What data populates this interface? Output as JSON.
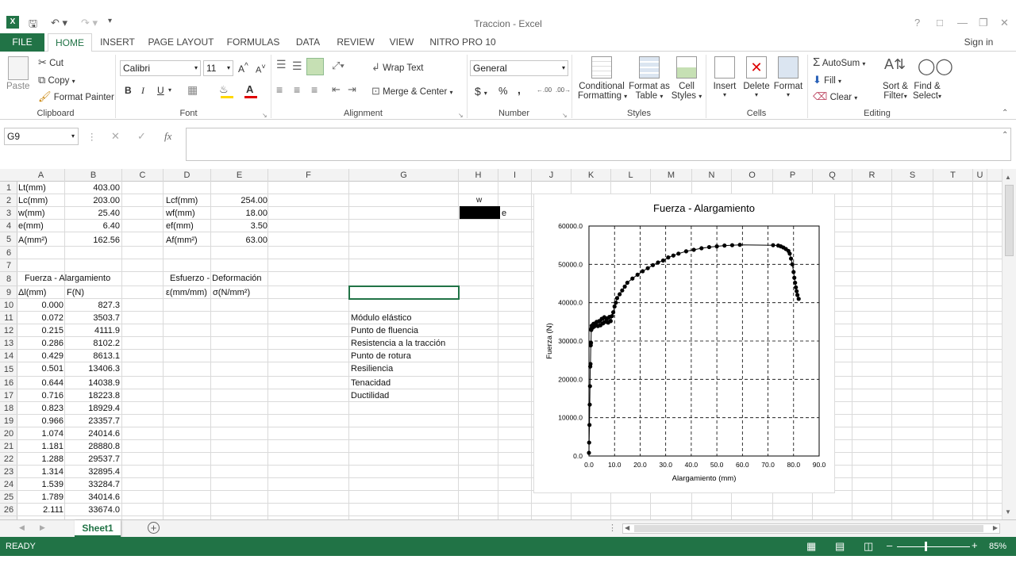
{
  "window": {
    "title": "Traccion - Excel",
    "sign_in": "Sign in",
    "help": "?"
  },
  "ribbon_tabs": [
    "FILE",
    "HOME",
    "INSERT",
    "PAGE LAYOUT",
    "FORMULAS",
    "DATA",
    "REVIEW",
    "VIEW",
    "NITRO PRO 10"
  ],
  "clipboard": {
    "paste": "Paste",
    "cut": "Cut",
    "copy": "Copy",
    "format_painter": "Format Painter",
    "label": "Clipboard"
  },
  "font": {
    "name": "Calibri",
    "size": "11",
    "label": "Font",
    "bold": "B",
    "italic": "I",
    "underline": "U"
  },
  "alignment": {
    "wrap": "Wrap Text",
    "merge": "Merge & Center",
    "label": "Alignment"
  },
  "number": {
    "format": "General",
    "currency": "$",
    "percent": "%",
    "comma": ",",
    "label": "Number"
  },
  "styles": {
    "conditional": "Conditional",
    "conditional2": "Formatting",
    "format_table": "Format as",
    "format_table2": "Table",
    "cell_styles": "Cell",
    "cell_styles2": "Styles",
    "label": "Styles"
  },
  "cells_group": {
    "insert": "Insert",
    "delete": "Delete",
    "format": "Format",
    "label": "Cells"
  },
  "editing": {
    "autosum": "AutoSum",
    "fill": "Fill",
    "clear": "Clear",
    "sort": "Sort &",
    "sort2": "Filter",
    "find": "Find &",
    "find2": "Select",
    "label": "Editing"
  },
  "formula_bar": {
    "name_box": "G9",
    "fx": "fx",
    "cancel": "✕",
    "enter": "✓",
    "value": ""
  },
  "columns": [
    "A",
    "B",
    "C",
    "D",
    "E",
    "F",
    "G",
    "H",
    "I",
    "J",
    "K",
    "L",
    "M",
    "N",
    "O",
    "P",
    "Q",
    "R",
    "S",
    "T",
    "U"
  ],
  "rows": [
    "1",
    "2",
    "3",
    "4",
    "5",
    "6",
    "7",
    "8",
    "9",
    "10",
    "11",
    "12",
    "13",
    "14",
    "15",
    "16",
    "17",
    "18",
    "19",
    "20",
    "21",
    "22",
    "23",
    "24",
    "25",
    "26"
  ],
  "sheet": {
    "a1": "Lt(mm)",
    "b1": "403.00",
    "a2": "Lc(mm)",
    "b2": "203.00",
    "d2": "Lcf(mm)",
    "e2": "254.00",
    "h2": "w",
    "a3": "w(mm)",
    "b3": "25.40",
    "d3": "wf(mm)",
    "e3": "18.00",
    "i3": "e",
    "a4": "e(mm)",
    "b4": "6.40",
    "d4": "ef(mm)",
    "e4": "3.50",
    "a5": "A(mm²)",
    "b5": "162.56",
    "d5": "Af(mm²)",
    "e5": "63.00",
    "a8": "Fuerza - Alargamiento",
    "d8": "Esfuerzo - Deformación",
    "a9": "Δl(mm)",
    "b9": "F(N)",
    "d9": "ε(mm/mm)",
    "e9": "σ(N/mm²)",
    "g_labels": [
      "Módulo elástico",
      "Punto de fluencia",
      "Resistencia a la tracción",
      "Punto de rotura",
      "Resiliencia",
      "Tenacidad",
      "Ductilidad"
    ],
    "dl": [
      "0.000",
      "0.072",
      "0.215",
      "0.286",
      "0.429",
      "0.501",
      "0.644",
      "0.716",
      "0.823",
      "0.966",
      "1.074",
      "1.181",
      "1.288",
      "1.314",
      "1.539",
      "1.789",
      "2.111"
    ],
    "f": [
      "827.3",
      "3503.7",
      "4111.9",
      "8102.2",
      "8613.1",
      "13406.3",
      "14038.9",
      "18223.8",
      "18929.4",
      "23357.7",
      "24014.6",
      "28880.8",
      "29537.7",
      "32895.4",
      "33284.7",
      "34014.6",
      "33674.0"
    ]
  },
  "sheet_tab": "Sheet1",
  "status": {
    "ready": "READY",
    "zoom": "85%"
  },
  "chart_data": {
    "type": "scatter",
    "title": "Fuerza - Alargamiento",
    "xlabel": "Alargamiento (mm)",
    "ylabel": "Fuerza (N)",
    "xlim": [
      0,
      90
    ],
    "ylim": [
      0,
      60000
    ],
    "xticks": [
      "0.0",
      "10.0",
      "20.0",
      "30.0",
      "40.0",
      "50.0",
      "60.0",
      "70.0",
      "80.0",
      "90.0"
    ],
    "yticks": [
      "0.0",
      "10000.0",
      "20000.0",
      "30000.0",
      "40000.0",
      "50000.0",
      "60000.0"
    ],
    "grid": true,
    "series": [
      {
        "x": [
          0.0,
          0.07,
          0.2,
          0.3,
          0.4,
          0.5,
          0.6,
          0.7,
          0.8,
          0.9,
          1.0,
          1.1,
          1.2,
          1.3,
          1.5,
          1.8,
          2.1,
          2.5,
          3,
          3.5,
          4,
          4.5,
          5,
          5.5,
          6,
          6.5,
          7,
          7.5,
          8,
          8.5,
          9,
          9.5,
          10,
          10.5,
          11,
          12,
          13,
          14,
          15,
          17,
          19,
          21,
          23,
          25,
          27,
          29,
          31,
          33,
          35,
          38,
          41,
          44,
          47,
          50,
          53,
          56,
          59,
          72,
          74,
          75,
          76,
          77,
          78,
          78.5,
          79,
          79.5,
          80,
          80.3,
          80.6,
          80.9,
          81.2,
          81.5,
          82
        ],
        "y": [
          827,
          3504,
          8102,
          13406,
          18224,
          23358,
          24015,
          28881,
          29538,
          32895,
          33285,
          34015,
          33674,
          34000,
          33500,
          34500,
          33800,
          34600,
          35000,
          33900,
          35200,
          34100,
          35800,
          34600,
          36200,
          35000,
          35900,
          34800,
          36300,
          35200,
          36500,
          37500,
          39000,
          40000,
          41200,
          42200,
          43200,
          44200,
          45200,
          46300,
          47300,
          48200,
          49000,
          49800,
          50500,
          51000,
          51800,
          52300,
          52800,
          53400,
          53800,
          54200,
          54500,
          54700,
          54900,
          55000,
          55100,
          55000,
          54900,
          54700,
          54400,
          54000,
          53500,
          52800,
          51500,
          50000,
          48000,
          46500,
          45200,
          44000,
          43000,
          42000,
          41000
        ]
      }
    ]
  }
}
